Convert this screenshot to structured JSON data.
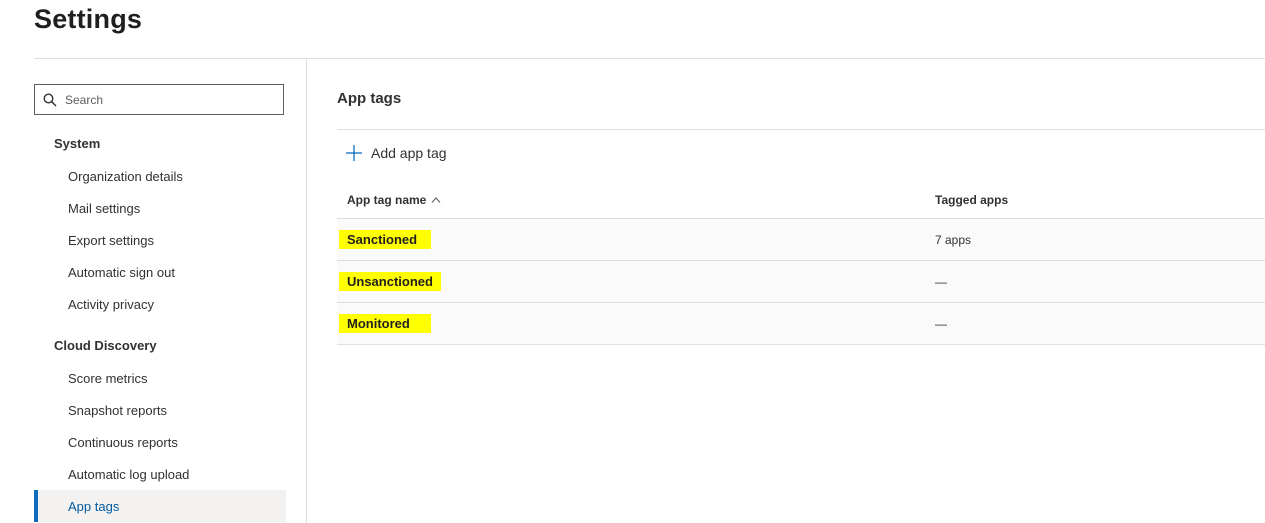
{
  "page": {
    "title": "Settings"
  },
  "sidebar": {
    "search": {
      "placeholder": "Search",
      "icon": "search-icon"
    },
    "groups": [
      {
        "title": "System",
        "items": [
          {
            "label": "Organization details"
          },
          {
            "label": "Mail settings"
          },
          {
            "label": "Export settings"
          },
          {
            "label": "Automatic sign out"
          },
          {
            "label": "Activity privacy"
          }
        ]
      },
      {
        "title": "Cloud Discovery",
        "items": [
          {
            "label": "Score metrics"
          },
          {
            "label": "Snapshot reports"
          },
          {
            "label": "Continuous reports"
          },
          {
            "label": "Automatic log upload"
          },
          {
            "label": "App tags",
            "active": true
          }
        ]
      }
    ]
  },
  "main": {
    "section_title": "App tags",
    "add_button": {
      "label": "Add app tag",
      "icon": "plus-icon"
    },
    "table": {
      "columns": [
        "App tag name",
        "Tagged apps"
      ],
      "sort": {
        "column": "App tag name",
        "direction": "ascending",
        "icon": "chevron-up-icon"
      },
      "rows": [
        {
          "name": "Sanctioned",
          "apps": "7 apps"
        },
        {
          "name": "Unsanctioned",
          "apps": "—"
        },
        {
          "name": "Monitored",
          "apps": "—"
        }
      ]
    }
  },
  "colors": {
    "accent": "#0f6cbd",
    "highlight": "#ffff00",
    "divider": "#e1dfdd",
    "active_item_background": "#f3f2f1"
  }
}
